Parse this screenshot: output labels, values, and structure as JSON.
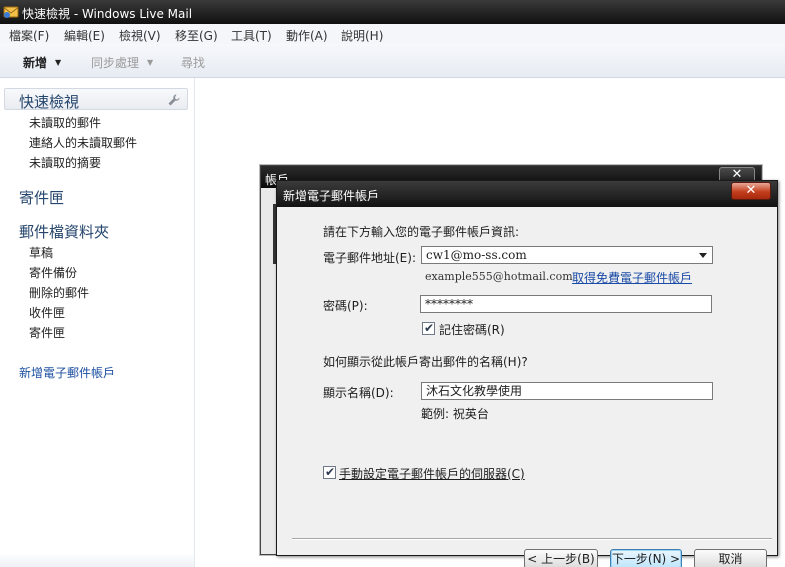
{
  "window": {
    "title": "快速檢視 - Windows Live Mail"
  },
  "menu": [
    "檔案(F)",
    "編輯(E)",
    "檢視(V)",
    "移至(G)",
    "工具(T)",
    "動作(A)",
    "說明(H)"
  ],
  "toolbar": {
    "new_label": "新增",
    "sync_label": "同步處理",
    "find_label": "尋找"
  },
  "sidebar": {
    "quick_views_title": "快速檢視",
    "quick_views": [
      "未讀取的郵件",
      "連絡人的未讀取郵件",
      "未讀取的摘要"
    ],
    "outbox_title": "寄件匣",
    "folders_title": "郵件檔資料夾",
    "folders": [
      "草稿",
      "寄件備份",
      "刪除的郵件",
      "收件匣",
      "寄件匣"
    ],
    "add_account_link": "新增電子郵件帳戶"
  },
  "background_dialog": {
    "title": "帳戶",
    "close_glyph": "✕"
  },
  "dialog": {
    "title": "新增電子郵件帳戶",
    "close_glyph": "✕",
    "intro": "請在下方輸入您的電子郵件帳戶資訊:",
    "email_label": "電子郵件地址(E):",
    "email_value": "cw1@mo-ss.com",
    "email_example": "example555@hotmail.com",
    "free_account_link": "取得免費電子郵件帳戶",
    "password_label": "密碼(P):",
    "password_value": "********",
    "remember_password_label": "記住密碼(R)",
    "remember_password_checked": true,
    "display_name_question": "如何顯示從此帳戶寄出郵件的名稱(H)?",
    "display_name_label": "顯示名稱(D):",
    "display_name_value": "沐石文化教學使用",
    "display_name_example": "範例: 祝英台",
    "manual_server_label": "手動設定電子郵件帳戶的伺服器(C)",
    "manual_server_checked": true,
    "check_glyph": "✔",
    "back_button": "< 上一步(B)",
    "next_button": "下一步(N) >",
    "cancel_button": "取消"
  },
  "colors": {
    "accent_blue": "#26466d",
    "link_blue": "#1c4fa0",
    "close_red": "#c33f1d"
  }
}
